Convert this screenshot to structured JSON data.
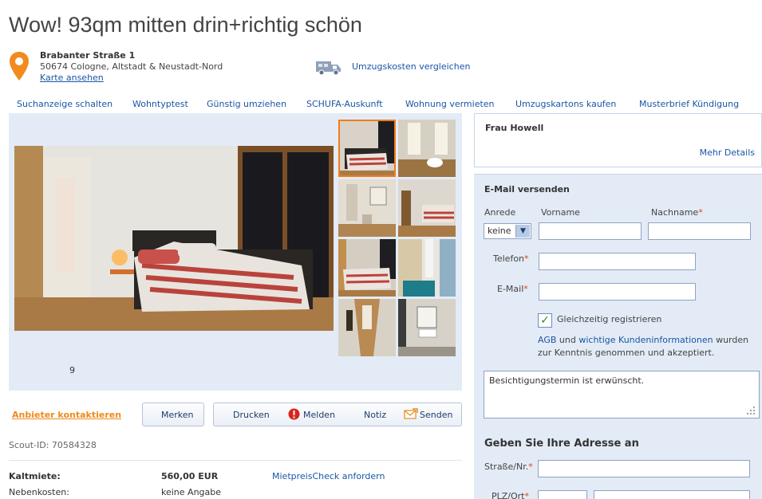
{
  "listing": {
    "title": "Wow! 93qm mitten drin+richtig schön",
    "street": "Brabanter Straße 1",
    "city": "50674 Cologne, Altstadt & Neustadt-Nord",
    "map_link": "Karte ansehen",
    "move_costs": "Umzugskosten vergleichen",
    "photo_count": "9"
  },
  "nav": {
    "items": [
      "Suchanzeige schalten",
      "Wohntyptest",
      "Günstig umziehen",
      "SCHUFA-Auskunft",
      "Wohnung vermieten",
      "Umzugskartons kaufen",
      "Musterbrief Kündigung"
    ]
  },
  "actions": {
    "contact": "Anbieter kontaktieren",
    "merken": "Merken",
    "drucken": "Drucken",
    "melden": "Melden",
    "notiz": "Notiz",
    "senden": "Senden"
  },
  "details": {
    "scout_id": "Scout-ID: 70584328",
    "rent_label": "Kaltmiete:",
    "rent_value": "560,00 EUR",
    "extra_label": "Nebenkosten:",
    "extra_value": "keine Angabe",
    "mietpreis_link": "MietpreisCheck anfordern"
  },
  "agent": {
    "name": "Frau Howell",
    "more": "Mehr Details"
  },
  "form": {
    "heading": "E-Mail versenden",
    "anrede_label": "Anrede",
    "anrede_value": "keine",
    "vorname_label": "Vorname",
    "nachname_label": "Nachname",
    "telefon_label": "Telefon",
    "email_label": "E-Mail",
    "required_mark": "*",
    "register_label": "Gleichzeitig registrieren",
    "agb_link": "AGB",
    "und": "und",
    "kundeninfo_link": "wichtige Kundeninformationen",
    "accepted_1": "wurden",
    "accepted_2": "zur Kenntnis genommen und akzeptiert.",
    "message": "Besichtigungstermin ist erwünscht.",
    "address_heading": "Geben Sie Ihre Adresse an",
    "street_label": "Straße/Nr.",
    "plz_label": "PLZ/Ort"
  },
  "colors": {
    "link": "#1a56a6",
    "accent": "#f27c1b",
    "panel": "#e3ebf6",
    "required": "#e2431a"
  }
}
